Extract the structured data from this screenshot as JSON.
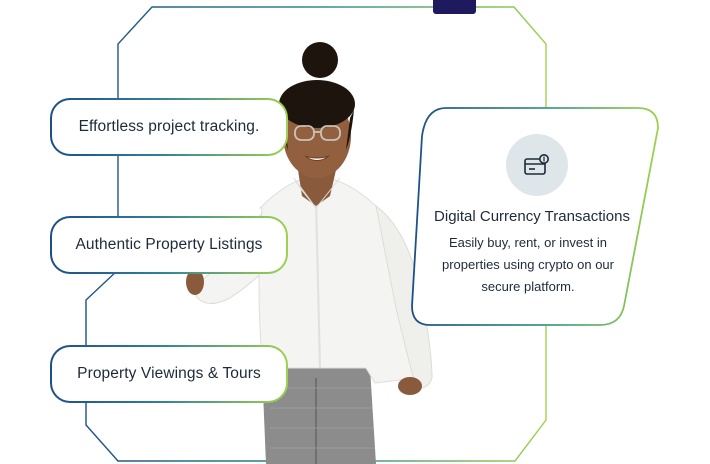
{
  "features": [
    {
      "label": "Effortless project tracking."
    },
    {
      "label": "Authentic Property Listings"
    },
    {
      "label": "Property Viewings & Tours"
    }
  ],
  "info_card": {
    "icon": "crypto-card-icon",
    "title": "Digital Currency Transactions",
    "description": "Easily buy, rent, or invest in properties using crypto on our secure platform."
  },
  "colors": {
    "gradient_start": "#1d4f86",
    "gradient_end": "#9fd24e",
    "icon_bg": "#dfe6ea",
    "text": "#1e2a3a",
    "shirt": "#f4f4f2",
    "trousers": "#8a8a8a"
  }
}
